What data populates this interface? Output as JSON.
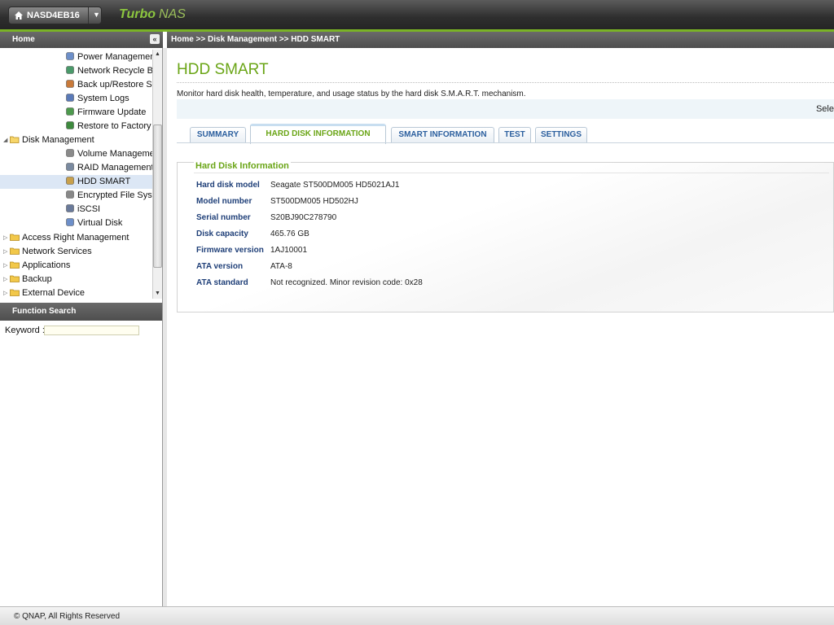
{
  "topbar": {
    "server_name": "NASD4EB16",
    "brand_primary": "Turbo",
    "brand_secondary": "NAS",
    "accent": "#7ab326"
  },
  "sidebar": {
    "header": "Home",
    "items": [
      {
        "label": "Power Management",
        "icon": "power-icon",
        "selected": false
      },
      {
        "label": "Network Recycle Bin",
        "icon": "recycle-icon",
        "selected": false
      },
      {
        "label": "Back up/Restore Settings",
        "icon": "backup-icon",
        "selected": false
      },
      {
        "label": "System Logs",
        "icon": "log-icon",
        "selected": false
      },
      {
        "label": "Firmware Update",
        "icon": "firmware-icon",
        "selected": false
      },
      {
        "label": "Restore to Factory Default",
        "icon": "factory-icon",
        "selected": false
      },
      {
        "label": "Disk Management",
        "icon": "folder-open-icon",
        "selected": false
      },
      {
        "label": "Volume Management",
        "icon": "volume-icon",
        "selected": false
      },
      {
        "label": "RAID Management",
        "icon": "raid-icon",
        "selected": false
      },
      {
        "label": "HDD SMART",
        "icon": "hdd-smart-icon",
        "selected": true
      },
      {
        "label": "Encrypted File System",
        "icon": "encrypt-icon",
        "selected": false
      },
      {
        "label": "iSCSI",
        "icon": "iscsi-icon",
        "selected": false
      },
      {
        "label": "Virtual Disk",
        "icon": "virtual-disk-icon",
        "selected": false
      },
      {
        "label": "Access Right Management",
        "icon": "folder-icon",
        "selected": false
      },
      {
        "label": "Network Services",
        "icon": "folder-icon",
        "selected": false
      },
      {
        "label": "Applications",
        "icon": "folder-icon",
        "selected": false
      },
      {
        "label": "Backup",
        "icon": "folder-icon",
        "selected": false
      },
      {
        "label": "External Device",
        "icon": "folder-icon",
        "selected": false
      }
    ],
    "function_search": {
      "header": "Function Search",
      "keyword_label": "Keyword :",
      "keyword_value": ""
    }
  },
  "breadcrumb": "Home >> Disk Management >> HDD SMART",
  "main": {
    "title": "HDD SMART",
    "description": "Monitor hard disk health, temperature, and usage status by the hard disk S.M.A.R.T. mechanism.",
    "select_text": "Sele",
    "tabs": [
      {
        "label": "SUMMARY",
        "active": false
      },
      {
        "label": "HARD DISK INFORMATION",
        "active": true
      },
      {
        "label": "SMART INFORMATION",
        "active": false
      },
      {
        "label": "TEST",
        "active": false
      },
      {
        "label": "SETTINGS",
        "active": false
      }
    ],
    "info": {
      "heading": "Hard Disk Information",
      "rows": [
        {
          "label": "Hard disk model",
          "value": "Seagate ST500DM005 HD5021AJ1"
        },
        {
          "label": "Model number",
          "value": "ST500DM005 HD502HJ"
        },
        {
          "label": "Serial number",
          "value": "S20BJ90C278790"
        },
        {
          "label": "Disk capacity",
          "value": "465.76 GB"
        },
        {
          "label": "Firmware version",
          "value": "1AJ10001"
        },
        {
          "label": "ATA version",
          "value": "ATA-8"
        },
        {
          "label": "ATA standard",
          "value": "Not recognized. Minor revision code: 0x28"
        }
      ]
    }
  },
  "footer": {
    "copyright": "© QNAP, All Rights Reserved"
  }
}
